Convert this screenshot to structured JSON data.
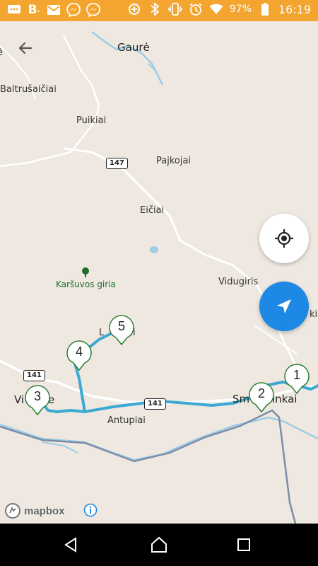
{
  "status_bar": {
    "battery": "97%",
    "time": "16:19",
    "left_icons": [
      "chat-icon",
      "booking-icon",
      "gmail-icon",
      "messenger-icon",
      "messenger-icon"
    ],
    "right_icons": [
      "data-saver-icon",
      "bluetooth-icon",
      "vibrate-icon",
      "alarm-icon",
      "wifi-icon",
      "battery-icon"
    ]
  },
  "map": {
    "places": {
      "gaure": "Gaurė",
      "baltrusaiciai": "Baltrušaičiai",
      "puikiai": "Puikiai",
      "pajkojai": "Pajkojai",
      "eiciai": "Eičiai",
      "vidugiris": "Vidugiris",
      "antupiai": "Antupiai",
      "vilkyske": "Vi",
      "vilkyske_end": "e",
      "smalininkai": "Sm",
      "smalininkai_end": "inkai",
      "left_edge": "ė",
      "lauk": "L",
      "lauk_end": "ai",
      "right_edge": "ki"
    },
    "park": "Karšuvos giria",
    "road_shields": {
      "r147": "147",
      "r141_left": "141",
      "r141_mid": "141"
    },
    "markers": [
      "1",
      "2",
      "3",
      "4",
      "5"
    ],
    "attribution": "mapbox"
  },
  "colors": {
    "status_bar": "#F3A530",
    "map_bg": "#EEE8E1",
    "route": "#3BA9D3",
    "fab_blue": "#1E88E5",
    "park_green": "#1E6E2A"
  }
}
